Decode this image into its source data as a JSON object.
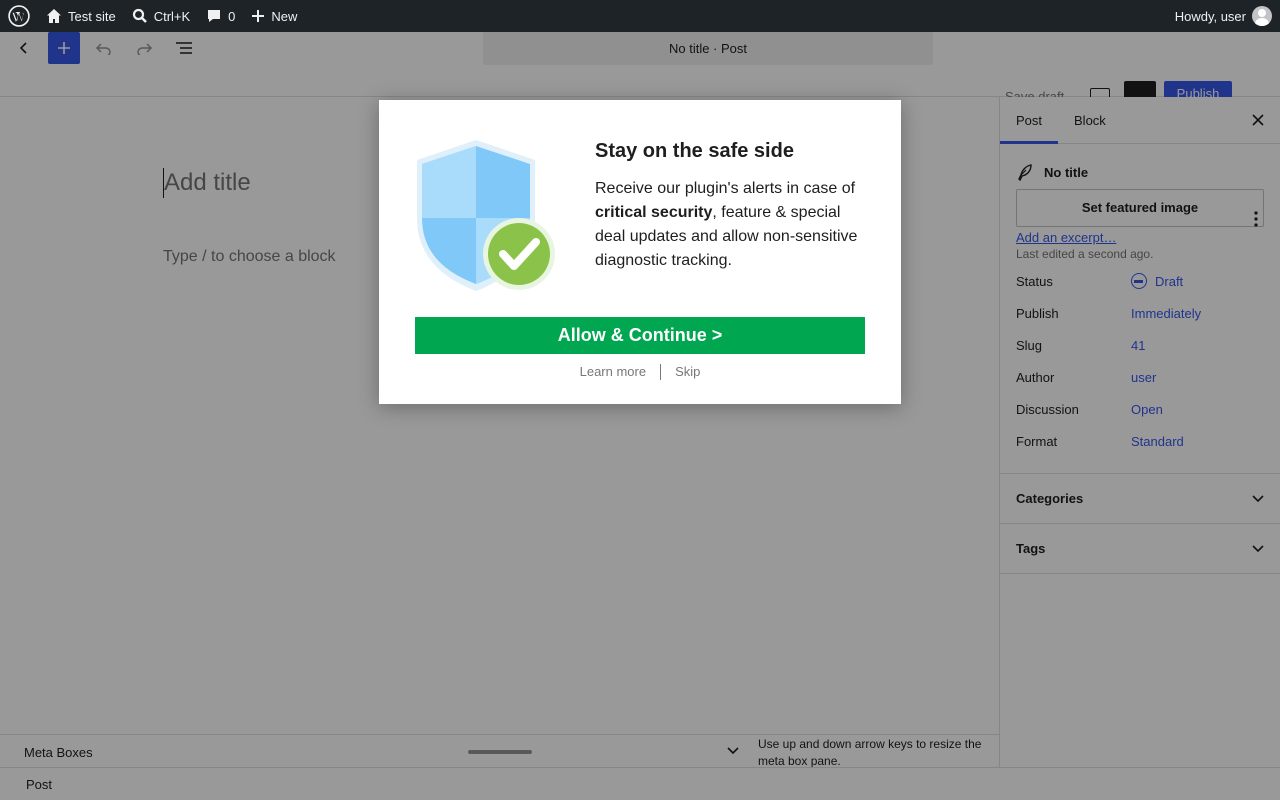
{
  "adminbar": {
    "site_name": "Test site",
    "search_shortcut": "Ctrl+K",
    "comments_count": "0",
    "new_label": "New",
    "howdy": "Howdy, user"
  },
  "header": {
    "doc_title": "No title · Post",
    "save_draft": "Save draft",
    "publish": "Publish"
  },
  "canvas": {
    "title_placeholder": "Add title",
    "block_placeholder": "Type / to choose a block"
  },
  "sidebar": {
    "tabs": [
      "Post",
      "Block"
    ],
    "post_title": "No title",
    "featured_image": "Set featured image",
    "excerpt_link": "Add an excerpt…",
    "last_edited": "Last edited a second ago.",
    "meta": [
      {
        "label": "Status",
        "value": "Draft"
      },
      {
        "label": "Publish",
        "value": "Immediately"
      },
      {
        "label": "Slug",
        "value": "41"
      },
      {
        "label": "Author",
        "value": "user"
      },
      {
        "label": "Discussion",
        "value": "Open"
      },
      {
        "label": "Format",
        "value": "Standard"
      }
    ],
    "sections": [
      "Categories",
      "Tags"
    ]
  },
  "metaboxes": {
    "title": "Meta Boxes",
    "hint": "Use up and down arrow keys to resize the meta box pane."
  },
  "footer": {
    "breadcrumb": "Post"
  },
  "modal": {
    "title": "Stay on the safe side",
    "body_pre": "Receive our plugin's alerts in case of ",
    "body_bold": "critical security",
    "body_post": ", feature & special deal updates and allow non-sensitive diagnostic tracking.",
    "allow_button": "Allow & Continue  >",
    "learn_more": "Learn more",
    "skip": "Skip"
  },
  "colors": {
    "accent": "#3858e9",
    "allow_green": "#00a650",
    "adminbar_bg": "#1d2327"
  }
}
